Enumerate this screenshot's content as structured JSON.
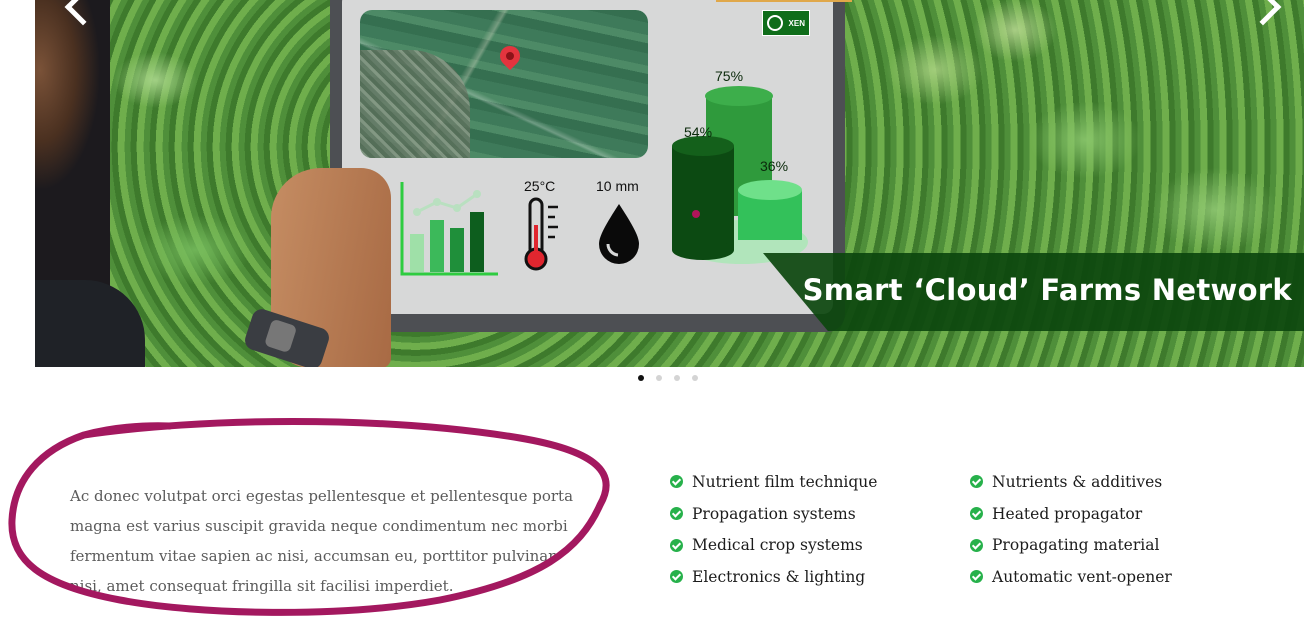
{
  "slider": {
    "banner_text": "Smart ‘Cloud’ Farms Network",
    "logo_text": "XEN",
    "screen": {
      "temperature": "25°C",
      "rainfall": "10 mm",
      "pie_percents": [
        "75%",
        "54%",
        "36%"
      ]
    },
    "nav": {
      "prev": "chevron-left-icon",
      "next": "chevron-right-icon"
    },
    "dots_count": 4,
    "active_dot": 1
  },
  "content": {
    "paragraph": "Ac donec volutpat orci egestas pellentesque et pellentesque porta magna est varius suscipit gravida neque condimentum nec morbi fermentum vitae sapien ac nisi, accumsan eu, porttitor pulvinar nisi, amet consequat fringilla sit facilisi imperdiet.",
    "features_left": [
      "Nutrient film technique",
      "Propagation systems",
      "Medical crop systems",
      "Electronics & lighting"
    ],
    "features_right": [
      "Nutrients & additives",
      "Heated propagator",
      "Propagating material",
      "Automatic vent-opener"
    ]
  },
  "colors": {
    "check": "#27b14b",
    "annotation": "#a3185f",
    "banner": "#0c460e"
  }
}
